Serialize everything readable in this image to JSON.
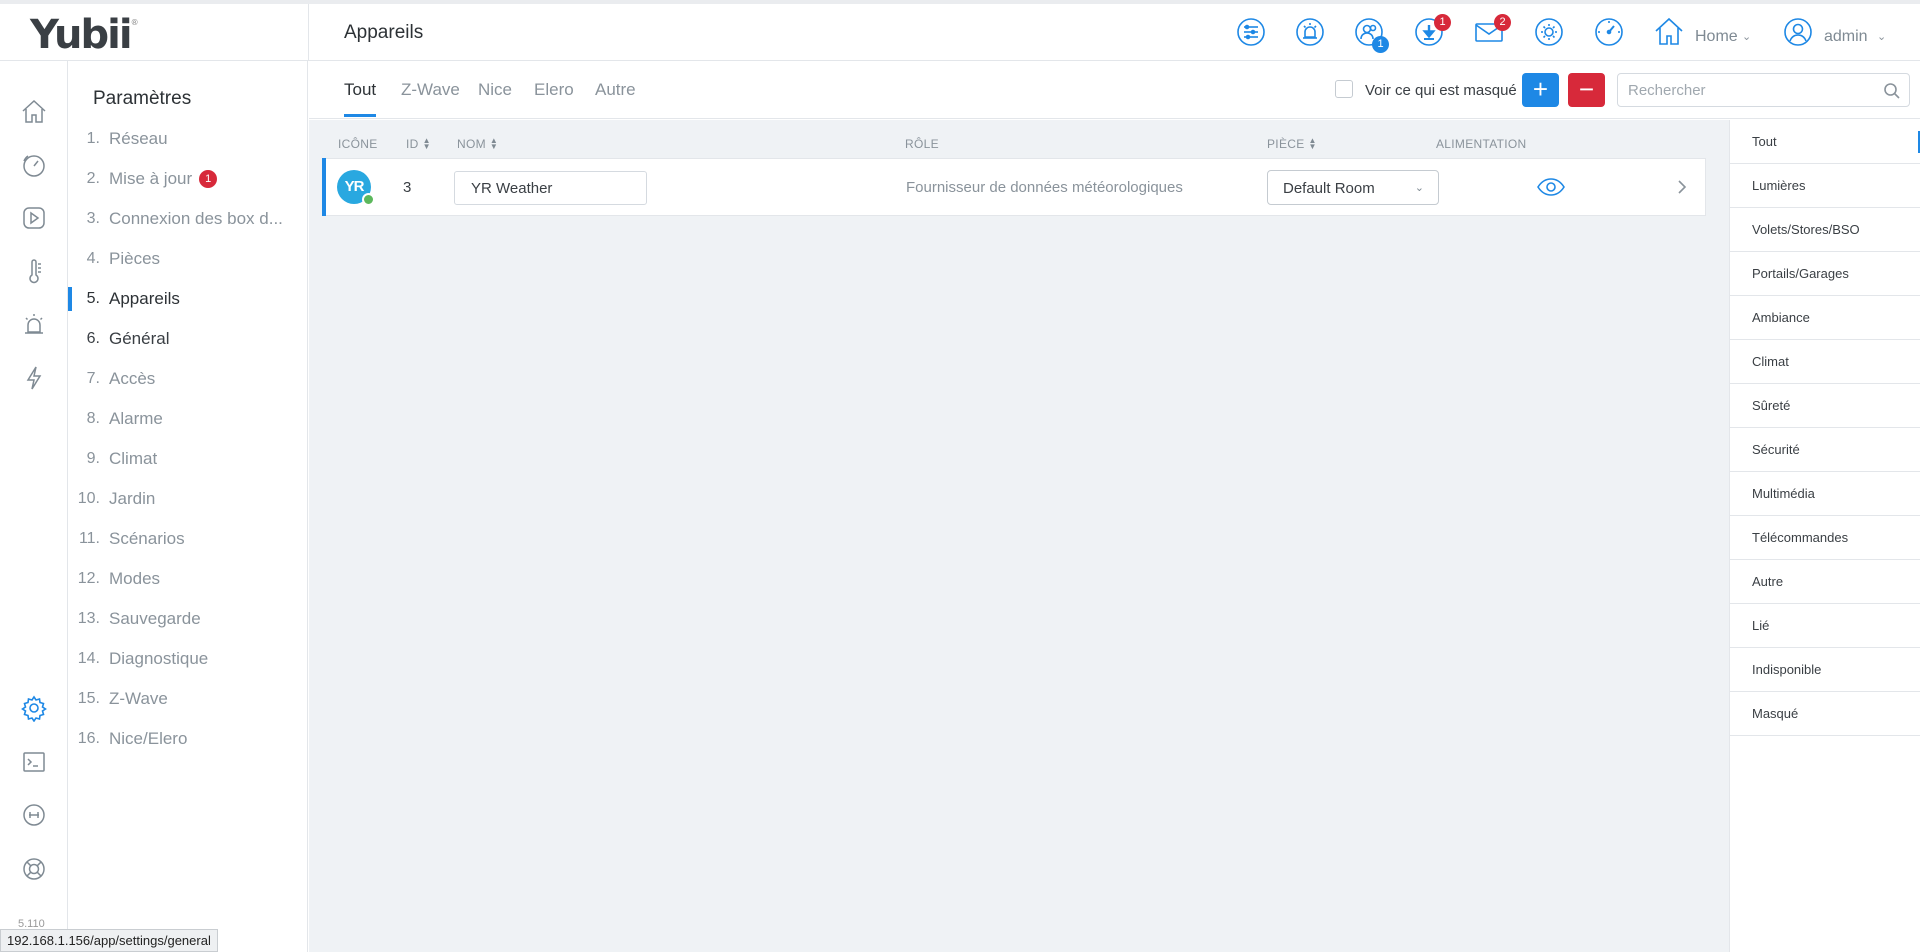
{
  "app": {
    "logo": "Yubii",
    "logo_mark": "®",
    "page_title": "Appareils"
  },
  "topbar": {
    "badges": {
      "users": "1",
      "downloads": "1",
      "messages": "2"
    },
    "home_label": "Home",
    "user_label": "admin"
  },
  "sidebar": {
    "title": "Paramètres",
    "items": [
      {
        "num": "1.",
        "label": "Réseau"
      },
      {
        "num": "2.",
        "label": "Mise à jour",
        "badge": "1"
      },
      {
        "num": "3.",
        "label": "Connexion des box d..."
      },
      {
        "num": "4.",
        "label": "Pièces"
      },
      {
        "num": "5.",
        "label": "Appareils"
      },
      {
        "num": "6.",
        "label": "Général"
      },
      {
        "num": "7.",
        "label": "Accès"
      },
      {
        "num": "8.",
        "label": "Alarme"
      },
      {
        "num": "9.",
        "label": "Climat"
      },
      {
        "num": "10.",
        "label": "Jardin"
      },
      {
        "num": "11.",
        "label": "Scénarios"
      },
      {
        "num": "12.",
        "label": "Modes"
      },
      {
        "num": "13.",
        "label": "Sauvegarde"
      },
      {
        "num": "14.",
        "label": "Diagnostique"
      },
      {
        "num": "15.",
        "label": "Z-Wave"
      },
      {
        "num": "16.",
        "label": "Nice/Elero"
      }
    ],
    "version": "5.110"
  },
  "tabs": [
    "Tout",
    "Z-Wave",
    "Nice",
    "Elero",
    "Autre"
  ],
  "toolbar": {
    "show_hidden_label": "Voir ce qui est masqué",
    "add_label": "+",
    "remove_label": "−",
    "search_placeholder": "Rechercher"
  },
  "table": {
    "headers": {
      "icon": "ICÔNE",
      "id": "ID",
      "name": "NOM",
      "role": "RÔLE",
      "room": "PIÈCE",
      "power": "ALIMENTATION"
    },
    "rows": [
      {
        "icon_text": "YR",
        "id": "3",
        "name": "YR Weather",
        "role": "Fournisseur de données météorologiques",
        "room": "Default Room"
      }
    ]
  },
  "filters": [
    "Tout",
    "Lumières",
    "Volets/Stores/BSO",
    "Portails/Garages",
    "Ambiance",
    "Climat",
    "Sûreté",
    "Sécurité",
    "Multimédia",
    "Télécommandes",
    "Autre",
    "Lié",
    "Indisponible",
    "Masqué"
  ],
  "status_url": "192.168.1.156/app/settings/general",
  "colors": {
    "accent": "#1e88e5",
    "danger": "#d7293a",
    "background": "#eff2f5"
  }
}
